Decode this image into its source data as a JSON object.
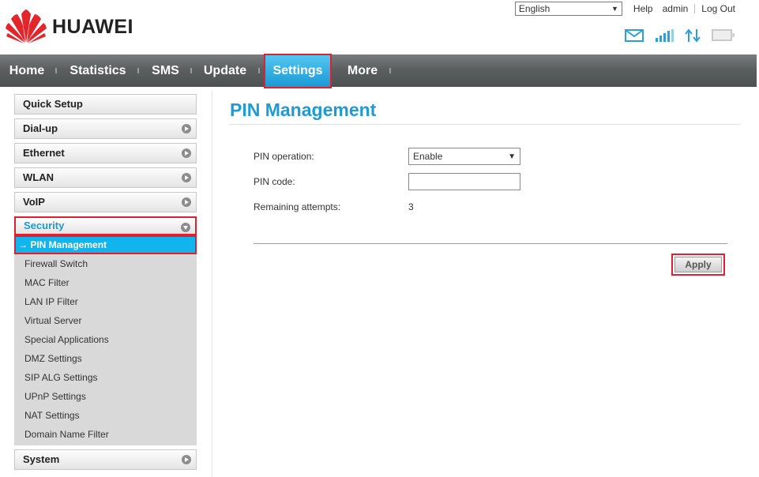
{
  "brand": {
    "name": "HUAWEI",
    "accent": "#1f9ad3",
    "highlight": "#e0202e"
  },
  "header": {
    "language": "English",
    "help_label": "Help",
    "user_label": "admin",
    "logout_label": "Log Out",
    "icons": [
      "mail-icon",
      "signal-icon",
      "data-transfer-icon",
      "connection-icon"
    ]
  },
  "nav": {
    "items": [
      {
        "label": "Home"
      },
      {
        "label": "Statistics"
      },
      {
        "label": "SMS"
      },
      {
        "label": "Update"
      },
      {
        "label": "Settings"
      },
      {
        "label": "More"
      }
    ],
    "active": "Settings"
  },
  "sidebar": {
    "items": [
      {
        "label": "Quick Setup"
      },
      {
        "label": "Dial-up"
      },
      {
        "label": "Ethernet"
      },
      {
        "label": "WLAN"
      },
      {
        "label": "VoIP"
      },
      {
        "label": "Security"
      },
      {
        "label": "System"
      }
    ],
    "security_sub": [
      {
        "label": "→ PIN Management"
      },
      {
        "label": "Firewall Switch"
      },
      {
        "label": "MAC Filter"
      },
      {
        "label": "LAN IP Filter"
      },
      {
        "label": "Virtual Server"
      },
      {
        "label": "Special Applications"
      },
      {
        "label": "DMZ Settings"
      },
      {
        "label": "SIP ALG Settings"
      },
      {
        "label": "UPnP Settings"
      },
      {
        "label": "NAT Settings"
      },
      {
        "label": "Domain Name Filter"
      }
    ]
  },
  "main": {
    "title": "PIN Management",
    "pin_operation_label": "PIN operation:",
    "pin_operation_value": "Enable",
    "pin_code_label": "PIN code:",
    "pin_code_value": "",
    "remaining_label": "Remaining attempts:",
    "remaining_value": "3",
    "apply_label": "Apply"
  }
}
